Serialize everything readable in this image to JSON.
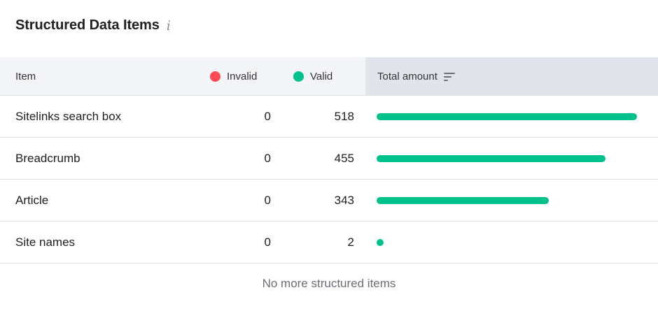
{
  "widget": {
    "title": "Structured Data Items",
    "info_icon": "info-icon"
  },
  "table": {
    "columns": {
      "item": "Item",
      "invalid": "Invalid",
      "valid": "Valid",
      "total": "Total amount"
    },
    "legend_colors": {
      "invalid": "#ff4953",
      "valid": "#00c08b"
    },
    "rows": [
      {
        "item": "Sitelinks search box",
        "invalid": "0",
        "valid": "518",
        "total_fraction": 1.0
      },
      {
        "item": "Breadcrumb",
        "invalid": "0",
        "valid": "455",
        "total_fraction": 0.878
      },
      {
        "item": "Article",
        "invalid": "0",
        "valid": "343",
        "total_fraction": 0.662
      },
      {
        "item": "Site names",
        "invalid": "0",
        "valid": "2",
        "total_fraction": 0.004
      }
    ]
  },
  "footer": {
    "text": "No more structured items"
  }
}
